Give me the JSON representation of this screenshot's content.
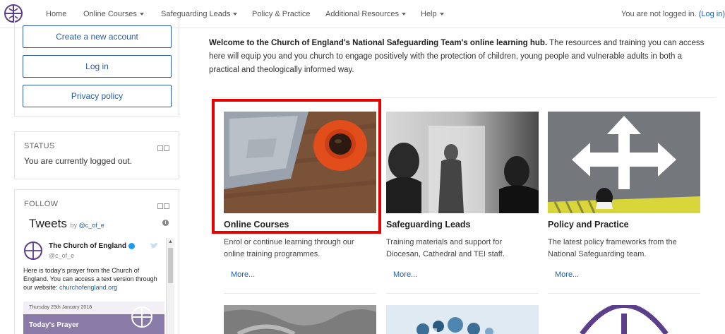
{
  "nav": {
    "items": [
      {
        "label": "Home",
        "dropdown": false
      },
      {
        "label": "Online Courses",
        "dropdown": true
      },
      {
        "label": "Safeguarding Leads",
        "dropdown": true
      },
      {
        "label": "Policy & Practice",
        "dropdown": false
      },
      {
        "label": "Additional Resources",
        "dropdown": true
      },
      {
        "label": "Help",
        "dropdown": true
      }
    ],
    "login_message": "You are not logged in.",
    "login_link": "(Log in)"
  },
  "sidebar": {
    "buttons": [
      "Create a new account",
      "Log in",
      "Privacy policy"
    ],
    "status": {
      "heading": "STATUS",
      "text": "You are currently logged out."
    },
    "follow": {
      "heading": "FOLLOW",
      "tweets_title": "Tweets",
      "tweets_by": "by",
      "tweets_handle": "@c_of_e",
      "tweet": {
        "name": "The Church of England",
        "handle": "@c_of_e",
        "text": "Here is today's prayer from the Church of England. You can access a text version through our website: ",
        "link": "churchofengland.org",
        "image_date": "Thursday 25th January 2018",
        "image_title": "Today's Prayer"
      }
    }
  },
  "main": {
    "intro_bold": "Welcome to the Church of England's National Safeguarding Team's online learning hub.",
    "intro_rest": " The resources and training you can access here will equip you and you church to engage positively with the protection of children, young people and vulnerable adults in both a practical and theologically informed way.",
    "cards": [
      {
        "title": "Online Courses",
        "desc": "Enrol or continue learning through our online training programmes.",
        "more": "More..."
      },
      {
        "title": "Safeguarding Leads",
        "desc": "Training materials and support for Diocesan, Cathedral and TEI staff.",
        "more": "More..."
      },
      {
        "title": "Policy and Practice",
        "desc": "The latest policy frameworks from the National Safeguarding team.",
        "more": "More..."
      }
    ]
  },
  "colors": {
    "accent": "#2a5ea2",
    "highlight": "#e60000",
    "link": "#1f5fa8"
  },
  "icons": [
    "church-of-england-logo-icon",
    "caret-down-icon",
    "block-collapse-icon",
    "twitter-bird-icon",
    "info-icon",
    "verified-icon"
  ]
}
